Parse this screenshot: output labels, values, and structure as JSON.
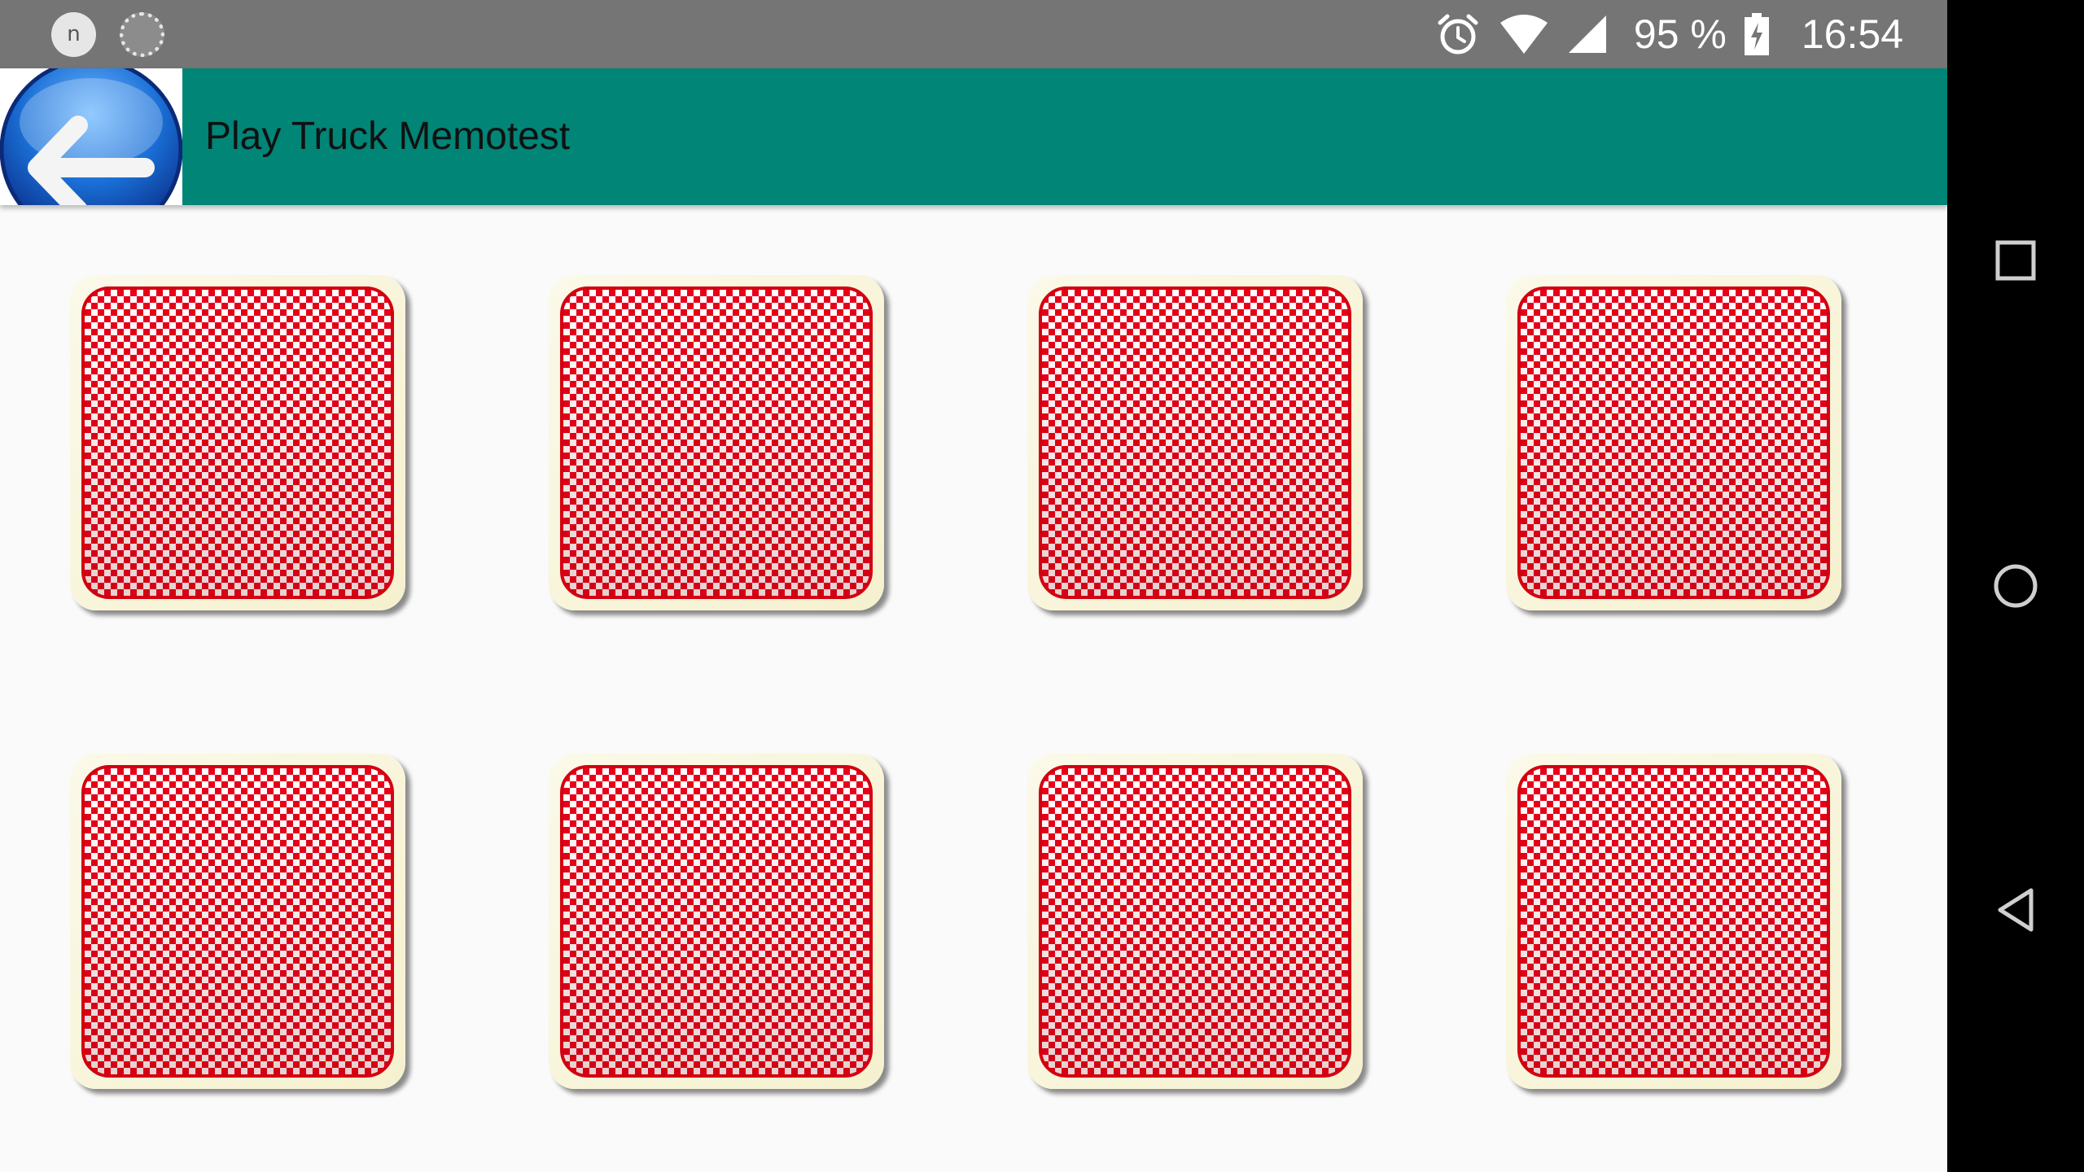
{
  "status_bar": {
    "notification_icons": [
      "n-notification-icon",
      "loading-icon"
    ],
    "notification_letter": "n",
    "battery_percent": "95 %",
    "clock": "16:54",
    "icons": [
      "alarm-icon",
      "wifi-icon",
      "cell-signal-icon",
      "battery-charging-icon"
    ]
  },
  "app_bar": {
    "title": "Play Truck Memotest",
    "back_icon": "back-arrow-icon",
    "background_color": "#008577"
  },
  "game": {
    "rows": 2,
    "columns": 4,
    "cards": [
      {
        "state": "face-down"
      },
      {
        "state": "face-down"
      },
      {
        "state": "face-down"
      },
      {
        "state": "face-down"
      },
      {
        "state": "face-down"
      },
      {
        "state": "face-down"
      },
      {
        "state": "face-down"
      },
      {
        "state": "face-down"
      }
    ],
    "card_back_color": "#e8001a"
  },
  "nav_bar": {
    "buttons": [
      "recents-button",
      "home-button",
      "back-button"
    ]
  }
}
